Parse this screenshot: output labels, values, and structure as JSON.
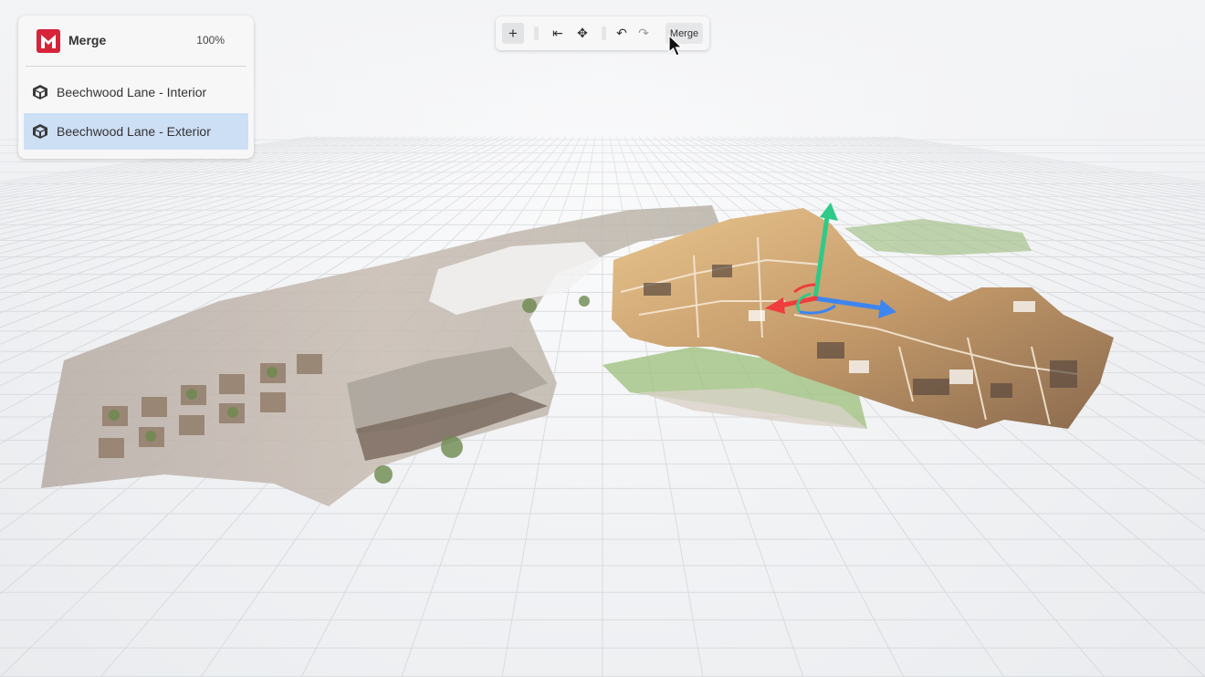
{
  "app": {
    "name": "Merge",
    "progress": "100%"
  },
  "models": [
    {
      "label": "Beechwood Lane - Interior",
      "selected": false
    },
    {
      "label": "Beechwood Lane - Exterior",
      "selected": true
    }
  ],
  "toolbar": {
    "add_icon": "+",
    "first_icon": "⇤",
    "move_icon": "✥",
    "undo_icon": "↶",
    "redo_icon": "↷",
    "merge_label": "Merge"
  },
  "icons": {
    "logo": "matterport-logo-icon",
    "model": "cube-icon",
    "gizmo": "transform-gizmo-icon"
  },
  "colors": {
    "accent": "#d6243a",
    "selected_row": "#cddff5",
    "axis_x": "#3d86f0",
    "axis_y": "#2fc98a",
    "axis_z": "#ef3d3d"
  }
}
